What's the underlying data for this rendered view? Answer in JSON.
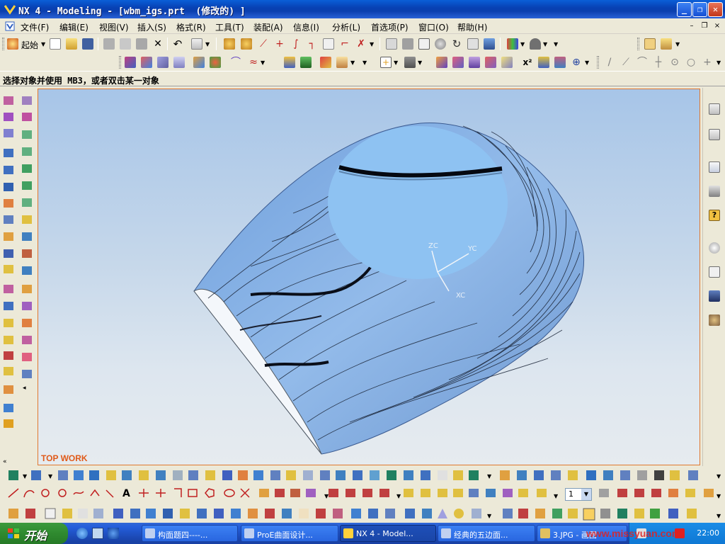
{
  "window": {
    "title": "NX 4 - Modeling - [wbm_igs.prt  (修改的) ]",
    "controls": [
      "_",
      "❐",
      "✕"
    ]
  },
  "menu": {
    "items": [
      "文件(F)",
      "编辑(E)",
      "视图(V)",
      "插入(S)",
      "格式(R)",
      "工具(T)",
      "装配(A)",
      "信息(I)",
      "分析(L)",
      "首选项(P)",
      "窗口(O)",
      "帮助(H)"
    ],
    "mdi_controls": [
      "–",
      "❐",
      "×"
    ]
  },
  "toolbar": {
    "start_label": "起始",
    "layer_value": "1"
  },
  "status": {
    "prompt": "选择对象并使用 MB3，或者双击某一对象"
  },
  "viewport": {
    "view_label": "TOP WORK",
    "axis_labels": {
      "zc": "ZC",
      "yc": "YC",
      "xc": "XC"
    }
  },
  "taskbar": {
    "start": "开始",
    "tasks": [
      {
        "label": "构面题四----...",
        "active": false
      },
      {
        "label": "ProE曲面设计...",
        "active": false
      },
      {
        "label": "NX 4 - Model...",
        "active": true
      },
      {
        "label": "经典的五边面...",
        "active": false
      },
      {
        "label": "3.JPG - 画图",
        "active": false
      }
    ],
    "clock": "22:00",
    "watermark": "www.missyuan.com"
  },
  "colors": {
    "title_blue": "#0842b5",
    "surface_blue": "#8fb6e6",
    "view_label_orange": "#e05a1a",
    "graphics_border": "#e07830"
  }
}
